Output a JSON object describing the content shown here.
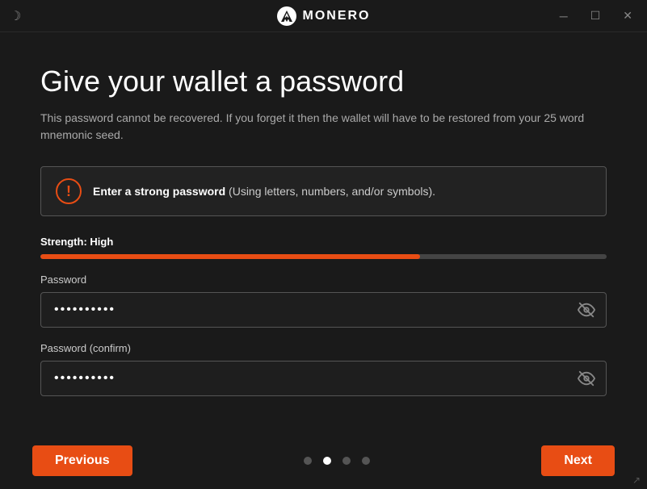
{
  "titleBar": {
    "appName": "MONERO",
    "moonIcon": "☽",
    "minimizeLabel": "─",
    "maximizeLabel": "☐",
    "closeLabel": "✕"
  },
  "page": {
    "title": "Give your wallet a password",
    "subtitle": "This password cannot be recovered. If you forget it then the wallet will have to be restored from your 25 word mnemonic seed.",
    "infoBox": {
      "text_strong": "Enter a strong password",
      "text_rest": " (Using letters, numbers, and/or symbols)."
    },
    "strength": {
      "label": "Strength: High",
      "fillPercent": 67
    },
    "passwordField": {
      "label": "Password",
      "placeholder": "",
      "value": "●●●●●●●●●●"
    },
    "confirmField": {
      "label": "Password (confirm)",
      "placeholder": "",
      "value": "●●●●●●●●●●"
    }
  },
  "footer": {
    "previousLabel": "Previous",
    "nextLabel": "Next",
    "dots": [
      {
        "active": false
      },
      {
        "active": true
      },
      {
        "active": false
      },
      {
        "active": false
      }
    ]
  },
  "colors": {
    "accent": "#e84d14",
    "bg": "#1a1a1a",
    "border": "#555555",
    "text": "#ffffff",
    "subtext": "#aaaaaa"
  }
}
